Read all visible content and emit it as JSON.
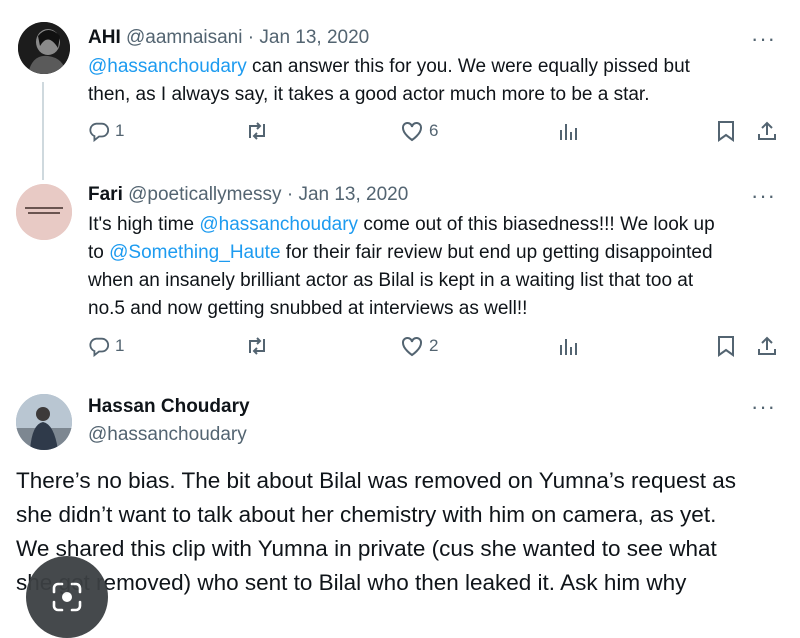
{
  "tweets": [
    {
      "name": "AHI",
      "handle": "@aamnaisani",
      "sep": "·",
      "date": "Jan 13, 2020",
      "lines": [
        [
          {
            "t": "@hassanchoudary",
            "m": true
          },
          {
            "t": " can answer this for you. We were equally pissed but",
            "m": false
          }
        ],
        [
          {
            "t": "then, as I always say, it takes a good actor much more to be a star.",
            "m": false
          }
        ]
      ],
      "replies": "1",
      "retweets": "",
      "likes": "6"
    },
    {
      "name": "Fari",
      "handle": "@poeticallymessy",
      "sep": "·",
      "date": "Jan 13, 2020",
      "lines": [
        [
          {
            "t": "It's high time ",
            "m": false
          },
          {
            "t": "@hassanchoudary",
            "m": true
          },
          {
            "t": " come out of this biasedness!!! We look up",
            "m": false
          }
        ],
        [
          {
            "t": "to ",
            "m": false
          },
          {
            "t": "@Something_Haute",
            "m": true
          },
          {
            "t": " for their fair review but end up getting disappointed",
            "m": false
          }
        ],
        [
          {
            "t": "when an insanely brilliant actor as Bilal is kept in a waiting list that too at",
            "m": false
          }
        ],
        [
          {
            "t": "no.5 and now getting snubbed at interviews as well!!",
            "m": false
          }
        ]
      ],
      "replies": "1",
      "retweets": "",
      "likes": "2"
    }
  ],
  "main_tweet": {
    "name": "Hassan Choudary",
    "handle": "@hassanchoudary",
    "lines": [
      "There’s no bias. The bit about Bilal was removed on Yumna’s request as",
      "she didn’t want to talk about her chemistry with him on camera, as yet.",
      "We shared this clip with Yumna in private (cus she wanted to see what",
      "she got removed) who sent to Bilal who then leaked it. Ask him why"
    ]
  },
  "more_glyph": "···",
  "icons": [
    "reply-icon",
    "retweet-icon",
    "like-icon",
    "views-icon",
    "bookmark-icon",
    "share-icon",
    "more-icon",
    "lens-icon"
  ],
  "colors": {
    "mention": "#1d9bf0",
    "muted": "#536471",
    "text": "#0f1419",
    "thread": "#cfd9de"
  }
}
